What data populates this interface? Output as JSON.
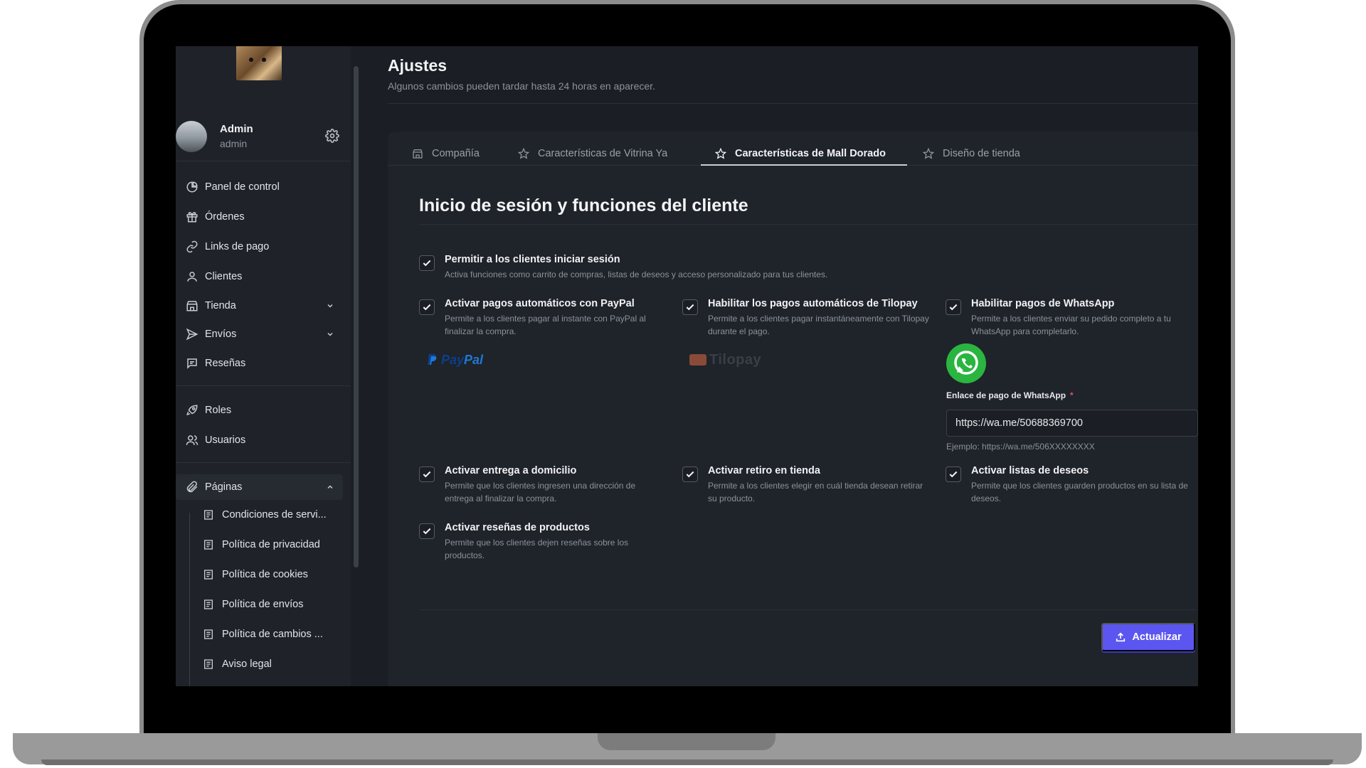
{
  "user": {
    "name": "Admin",
    "role": "admin"
  },
  "sidebar": {
    "items": [
      {
        "label": "Panel de control",
        "icon": "dashboard-icon"
      },
      {
        "label": "Órdenes",
        "icon": "gift-icon"
      },
      {
        "label": "Links de pago",
        "icon": "link-icon"
      },
      {
        "label": "Clientes",
        "icon": "user-icon"
      },
      {
        "label": "Tienda",
        "icon": "store-icon"
      },
      {
        "label": "Envíos",
        "icon": "send-icon"
      },
      {
        "label": "Reseñas",
        "icon": "message-icon"
      },
      {
        "label": "Roles",
        "icon": "rocket-icon"
      },
      {
        "label": "Usuarios",
        "icon": "users-icon"
      },
      {
        "label": "Páginas",
        "icon": "paperclip-icon"
      }
    ],
    "pages": [
      "Condiciones de servi...",
      "Política de privacidad",
      "Política de cookies",
      "Política de envíos",
      "Política de cambios ...",
      "Aviso legal"
    ]
  },
  "header": {
    "title": "Ajustes",
    "subtitle": "Algunos cambios pueden tardar hasta 24 horas en aparecer."
  },
  "tabs": [
    {
      "label": "Compañía",
      "icon": "store-icon",
      "active": false
    },
    {
      "label": "Características de Vitrina Ya",
      "icon": "star-icon",
      "active": false
    },
    {
      "label": "Características de Mall Dorado",
      "icon": "star-icon",
      "active": true
    },
    {
      "label": "Diseño de tienda",
      "icon": "star-icon",
      "active": false
    }
  ],
  "section": {
    "title": "Inicio de sesión y funciones del cliente",
    "options": [
      {
        "title": "Permitir a los clientes iniciar sesión",
        "desc": "Activa funciones como carrito de compras, listas de deseos y acceso personalizado para tus clientes.",
        "checked": true
      },
      {
        "title": "Activar pagos automáticos con PayPal",
        "desc": "Permite a los clientes pagar al instante con PayPal al finalizar la compra.",
        "checked": true
      },
      {
        "title": "Habilitar los pagos automáticos de Tilopay",
        "desc": "Permite a los clientes pagar instantáneamente con Tilopay durante el pago.",
        "checked": true
      },
      {
        "title": "Habilitar pagos de WhatsApp",
        "desc": "Permite a los clientes enviar su pedido completo a tu WhatsApp para completarlo.",
        "checked": true
      },
      {
        "title": "Activar entrega a domicilio",
        "desc": "Permite que los clientes ingresen una dirección de entrega al finalizar la compra.",
        "checked": true
      },
      {
        "title": "Activar retiro en tienda",
        "desc": "Permite a los clientes elegir en cuál tienda desean retirar su producto.",
        "checked": true
      },
      {
        "title": "Activar listas de deseos",
        "desc": "Permite que los clientes guarden productos en su lista de deseos.",
        "checked": true
      },
      {
        "title": "Activar reseñas de productos",
        "desc": "Permite que los clientes dejen reseñas sobre los productos.",
        "checked": true
      }
    ],
    "logos": {
      "paypal_a": "Pay",
      "paypal_b": "Pal",
      "tilopay": "Tilopay"
    },
    "whatsapp": {
      "label": "Enlace de pago de WhatsApp",
      "required_mark": "*",
      "value": "https://wa.me/50688369700",
      "helper": "Ejemplo: https://wa.me/506XXXXXXXX"
    }
  },
  "actions": {
    "update_label": "Actualizar"
  },
  "colors": {
    "accent": "#5b56f0",
    "whatsapp": "#2ab540",
    "background": "#1b1e24"
  }
}
